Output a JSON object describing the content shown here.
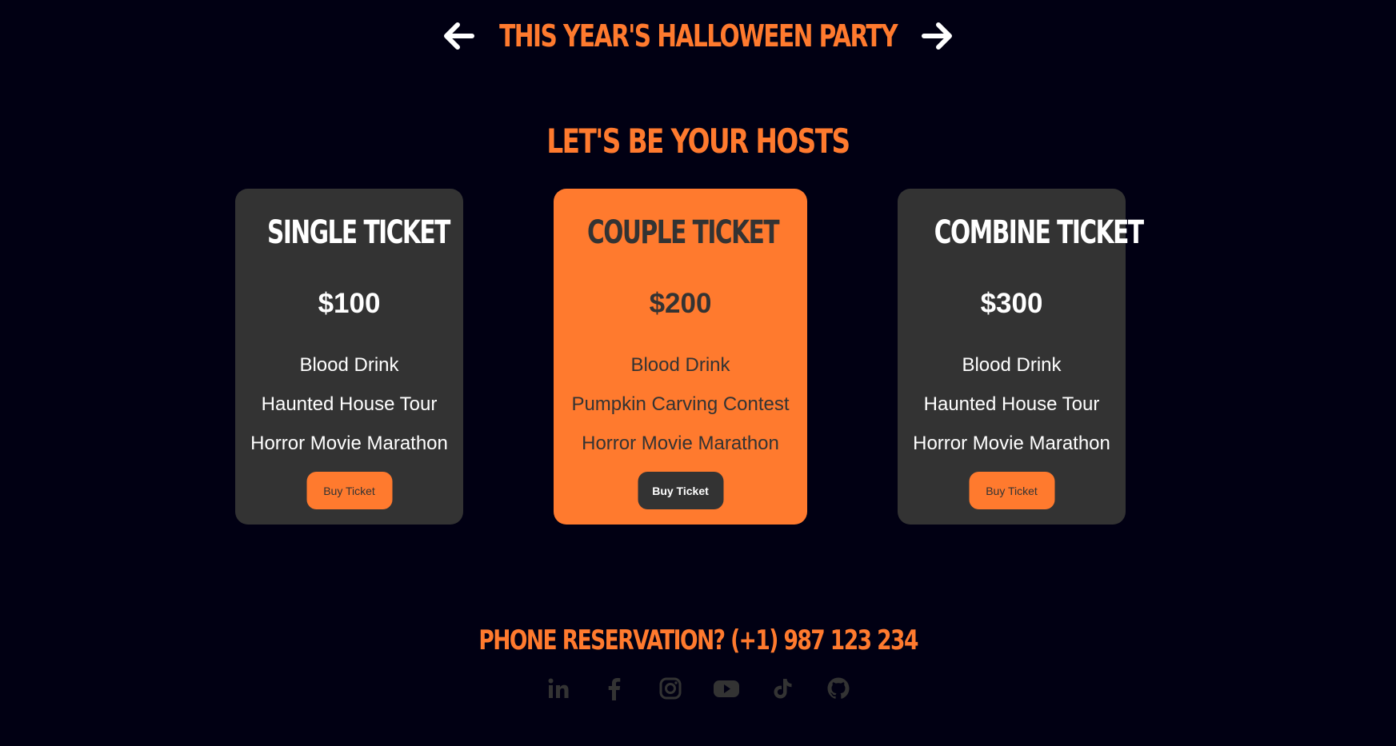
{
  "header": {
    "title": "THIS YEAR'S HALLOWEEN PARTY",
    "prev_icon": "arrow-left-icon",
    "next_icon": "arrow-right-icon"
  },
  "hosts": {
    "title": "LET'S BE YOUR HOSTS"
  },
  "tickets": [
    {
      "name": "SINGLE TICKET",
      "price": "$100",
      "features": [
        "Blood Drink",
        "Haunted House Tour",
        "Horror Movie Marathon"
      ],
      "button_label": "Buy Ticket",
      "featured": false
    },
    {
      "name": "COUPLE TICKET",
      "price": "$200",
      "features": [
        "Blood Drink",
        "Pumpkin Carving Contest",
        "Horror Movie Marathon"
      ],
      "button_label": "Buy Ticket",
      "featured": true
    },
    {
      "name": "COMBINE TICKET",
      "price": "$300",
      "features": [
        "Blood Drink",
        "Haunted House Tour",
        "Horror Movie Marathon"
      ],
      "button_label": "Buy Ticket",
      "featured": false
    }
  ],
  "footer": {
    "phone_text": "PHONE RESERVATION? (+1) 987 123 234",
    "social_icons": [
      "linkedin-icon",
      "facebook-icon",
      "instagram-icon",
      "youtube-icon",
      "tiktok-icon",
      "github-icon"
    ]
  },
  "colors": {
    "background": "#010013",
    "accent": "#ff7a2e",
    "card": "#333333",
    "text_light": "#ffffff"
  }
}
